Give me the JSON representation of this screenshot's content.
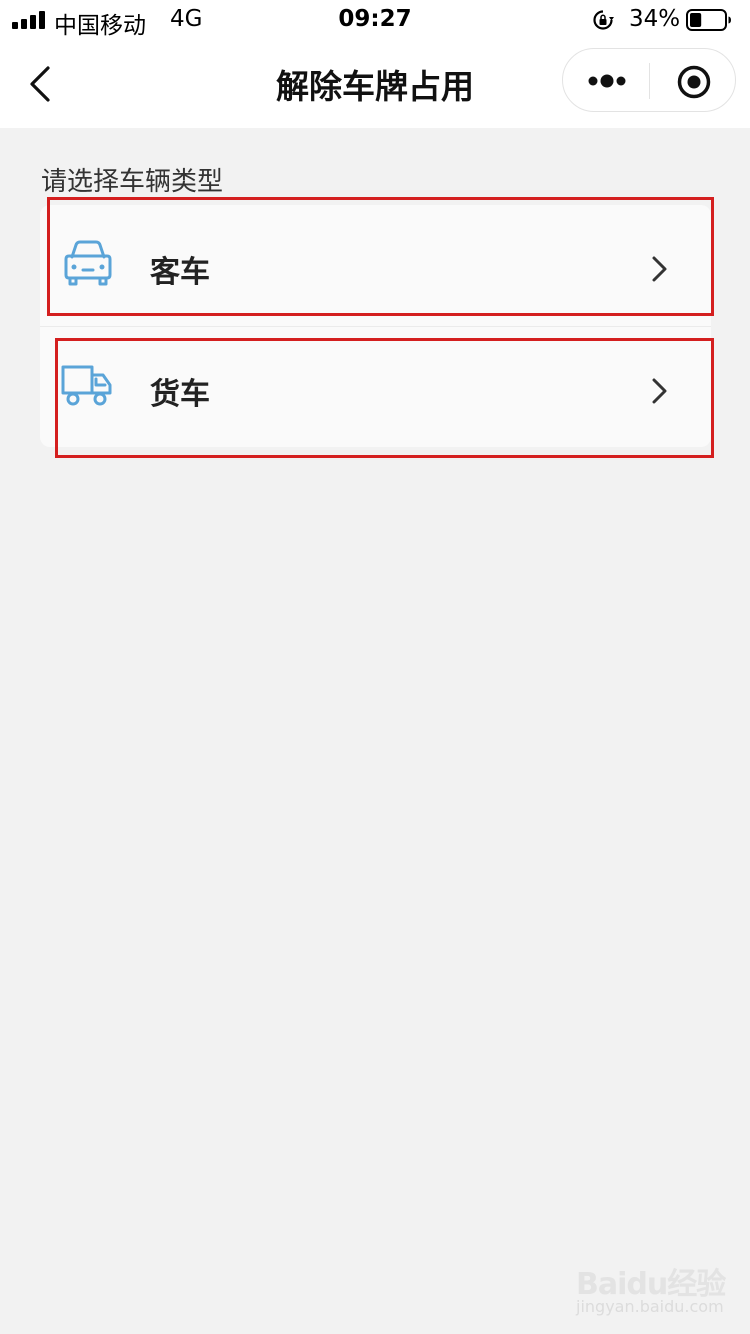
{
  "status_bar": {
    "carrier": "中国移动",
    "network": "4G",
    "time": "09:27",
    "battery_percent": "34%",
    "battery_level": 0.34
  },
  "nav": {
    "title": "解除车牌占用",
    "back_icon": "chevron-left-icon",
    "more_icon": "more-dots-icon",
    "close_icon": "target-circle-icon"
  },
  "section": {
    "label": "请选择车辆类型"
  },
  "vehicle_types": [
    {
      "label": "客车",
      "icon": "car-icon"
    },
    {
      "label": "货车",
      "icon": "truck-icon"
    }
  ],
  "colors": {
    "icon_blue": "#5aa4d8",
    "highlight_red": "#d41f1f",
    "page_bg": "#f2f2f2"
  },
  "watermark": {
    "main": "Baidu经验",
    "sub": "jingyan.baidu.com"
  }
}
